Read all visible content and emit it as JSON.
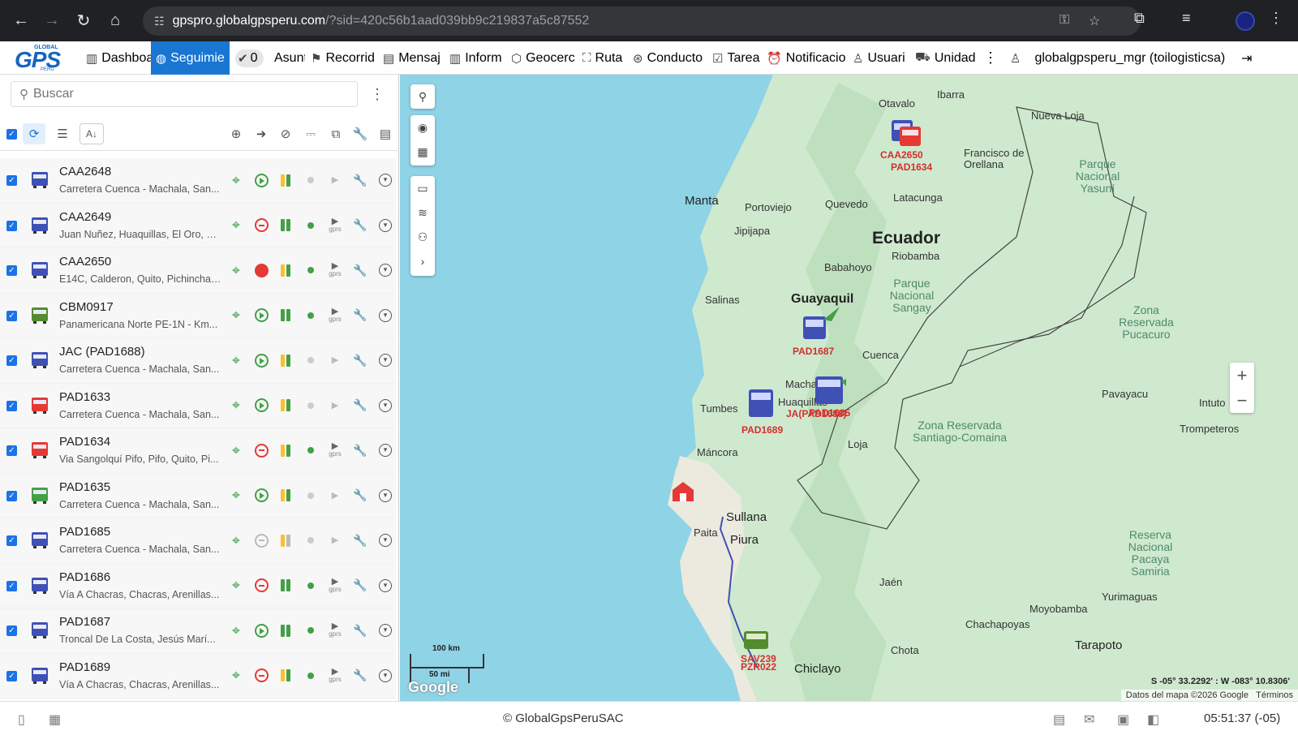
{
  "browser": {
    "url_host": "gpspro.globalgpsperu.com",
    "url_path": "/?sid=420c56b1aad039bb9c219837a5c87552"
  },
  "menu": {
    "items": [
      {
        "label": "Dashboa",
        "icon": "bar-chart-icon"
      },
      {
        "label": "Seguimie",
        "icon": "globe-icon"
      },
      {
        "label": "0",
        "icon": "check-circle-icon"
      },
      {
        "label": "Asunt",
        "icon": ""
      },
      {
        "label": "Recorrid",
        "icon": "flag-icon"
      },
      {
        "label": "Mensaj",
        "icon": "message-icon"
      },
      {
        "label": "Inform",
        "icon": "report-icon"
      },
      {
        "label": "Geocerc",
        "icon": "geofence-icon"
      },
      {
        "label": "Ruta",
        "icon": "route-icon"
      },
      {
        "label": "Conducto",
        "icon": "driver-icon"
      },
      {
        "label": "Tarea",
        "icon": "task-icon"
      },
      {
        "label": "Notificacio",
        "icon": "alarm-icon"
      },
      {
        "label": "Usuari",
        "icon": "user-icon"
      },
      {
        "label": "Unidad",
        "icon": "vehicle-icon"
      }
    ],
    "user": "globalgpsperu_mgr (toilogisticsa)"
  },
  "search": {
    "placeholder": "Buscar"
  },
  "units": [
    {
      "name": "CAA2648",
      "address": "Carretera Cuenca - Machala, San...",
      "color": "#3f51b5",
      "status": "go",
      "bar1": "#fbc02d",
      "bar2": "#43a047",
      "dot": "#ccc",
      "gprs": false
    },
    {
      "name": "CAA2649",
      "address": "Juan Nuñez, Huaquillas, El Oro, E...",
      "color": "#3f51b5",
      "status": "stop",
      "bar1": "#43a047",
      "bar2": "#43a047",
      "dot": "#43a047",
      "gprs": true
    },
    {
      "name": "CAA2650",
      "address": "E14C, Calderon, Quito, Pichincha,...",
      "color": "#3f51b5",
      "status": "stopred",
      "bar1": "#fbc02d",
      "bar2": "#43a047",
      "dot": "#43a047",
      "gprs": true
    },
    {
      "name": "CBM0917",
      "address": "Panamericana Norte PE-1N - Km...",
      "color": "#558b2f",
      "status": "go",
      "bar1": "#43a047",
      "bar2": "#43a047",
      "dot": "#43a047",
      "gprs": true
    },
    {
      "name": "JAC (PAD1688)",
      "address": "Carretera Cuenca - Machala, San...",
      "color": "#3f51b5",
      "status": "go",
      "bar1": "#fbc02d",
      "bar2": "#43a047",
      "dot": "#ccc",
      "gprs": false
    },
    {
      "name": "PAD1633",
      "address": "Carretera Cuenca - Machala, San...",
      "color": "#e53935",
      "status": "go",
      "bar1": "#fbc02d",
      "bar2": "#43a047",
      "dot": "#ccc",
      "gprs": false
    },
    {
      "name": "PAD1634",
      "address": "Via Sangolquí Pifo, Pifo, Quito, Pi...",
      "color": "#e53935",
      "status": "stop",
      "bar1": "#fbc02d",
      "bar2": "#43a047",
      "dot": "#43a047",
      "gprs": true
    },
    {
      "name": "PAD1635",
      "address": "Carretera Cuenca - Machala, San...",
      "color": "#43a047",
      "status": "go",
      "bar1": "#fbc02d",
      "bar2": "#43a047",
      "dot": "#ccc",
      "gprs": false
    },
    {
      "name": "PAD1685",
      "address": "Carretera Cuenca - Machala, San...",
      "color": "#3f51b5",
      "status": "stopgray",
      "bar1": "#fbc02d",
      "bar2": "#bbb",
      "dot": "#ccc",
      "gprs": false
    },
    {
      "name": "PAD1686",
      "address": "Vía A Chacras, Chacras, Arenillas...",
      "color": "#3f51b5",
      "status": "stop",
      "bar1": "#43a047",
      "bar2": "#43a047",
      "dot": "#43a047",
      "gprs": true
    },
    {
      "name": "PAD1687",
      "address": "Troncal De La Costa, Jesús Marí...",
      "color": "#3f51b5",
      "status": "go",
      "bar1": "#43a047",
      "bar2": "#43a047",
      "dot": "#43a047",
      "gprs": true
    },
    {
      "name": "PAD1689",
      "address": "Vía A Chacras, Chacras, Arenillas...",
      "color": "#3f51b5",
      "status": "stop",
      "bar1": "#fbc02d",
      "bar2": "#43a047",
      "dot": "#43a047",
      "gprs": true
    }
  ],
  "map": {
    "country": "Ecuador",
    "cities": [
      "Otavalo",
      "Ibarra",
      "Nueva Loja",
      "Francisco de Orellana",
      "Manta",
      "Portoviejo",
      "Quevedo",
      "Latacunga",
      "Jipijapa",
      "Riobamba",
      "Babahoyo",
      "Salinas",
      "Guayaquil",
      "Cuenca",
      "Machala",
      "Huaquillas",
      "Tumbes",
      "Loja",
      "Máncora",
      "Sullana",
      "Paita",
      "Piura",
      "Jaén",
      "Moyobamba",
      "Yurimaguas",
      "Chachapoyas",
      "Tarapoto",
      "Chota",
      "Chiclayo",
      "Pavayacu",
      "Intuto",
      "Trompeteros"
    ],
    "parks": [
      "Parque Nacional Yasuní",
      "Parque Nacional Sangay",
      "Zona Reservada Pucacuro",
      "Zona Reservada Santiago-Comaina",
      "Reserva Nacional Pacaya Samiria"
    ],
    "vehicles": [
      "CAA2650",
      "PAD1634",
      "PAD1687",
      "PAD1689",
      "JA(PAD1688)",
      "PAD1685",
      "CAA2649",
      "SAV239",
      "PZR022"
    ],
    "scale_km": "100 km",
    "scale_mi": "50 mi",
    "coords": "S -05° 33.2292' : W -083° 10.8306'",
    "attribution": "Datos del mapa ©2026 Google",
    "terms": "Términos",
    "google": "Google"
  },
  "footer": {
    "copyright": "© GlobalGpsPeruSAC",
    "time": "05:51:37 (-05)"
  }
}
